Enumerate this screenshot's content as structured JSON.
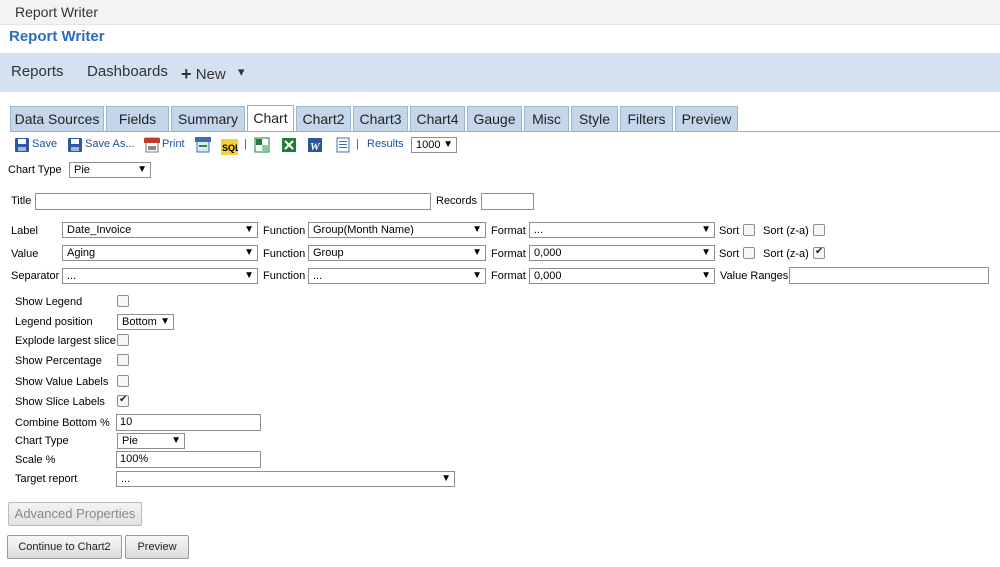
{
  "window": {
    "title": "Report Writer"
  },
  "header": {
    "brand": "Report Writer"
  },
  "nav": {
    "reports": "Reports",
    "dashboards": "Dashboards",
    "new_plus": "+",
    "new": "New",
    "caret": "▾"
  },
  "tabs": [
    {
      "label": "Data Sources",
      "active": false
    },
    {
      "label": "Fields",
      "active": false
    },
    {
      "label": "Summary",
      "active": false
    },
    {
      "label": "Chart",
      "active": true
    },
    {
      "label": "Chart2",
      "active": false
    },
    {
      "label": "Chart3",
      "active": false
    },
    {
      "label": "Chart4",
      "active": false
    },
    {
      "label": "Gauge",
      "active": false
    },
    {
      "label": "Misc",
      "active": false
    },
    {
      "label": "Style",
      "active": false
    },
    {
      "label": "Filters",
      "active": false
    },
    {
      "label": "Preview",
      "active": false
    }
  ],
  "toolbar": {
    "save": "Save",
    "save_as": "Save As...",
    "print": "Print",
    "sep": "|",
    "results_label": "Results",
    "results_value": "1000",
    "icons": [
      "save-icon",
      "save-as-icon",
      "pdf-icon",
      "html-icon",
      "sql-icon",
      "excel-icon",
      "excel2-icon",
      "word-icon",
      "doc-icon"
    ]
  },
  "chart_type_top": {
    "label": "Chart Type",
    "value": "Pie"
  },
  "title_row": {
    "title_label": "Title",
    "title_value": "",
    "records_label": "Records",
    "records_value": ""
  },
  "rows": {
    "label": {
      "name": "Label",
      "field": "Date_Invoice",
      "function_label": "Function",
      "function": "Group(Month Name)",
      "format_label": "Format",
      "format": "...",
      "sort_label": "Sort",
      "sort_za_label": "Sort (z-a)",
      "sort": false,
      "sort_za": false
    },
    "value": {
      "name": "Value",
      "field": "Aging",
      "function_label": "Function",
      "function": "Group",
      "format_label": "Format",
      "format": "0,000",
      "sort_label": "Sort",
      "sort_za_label": "Sort (z-a)",
      "sort": false,
      "sort_za": true
    },
    "separator": {
      "name": "Separator",
      "field": "...",
      "function_label": "Function",
      "function": "...",
      "format_label": "Format",
      "format": "0,000",
      "value_ranges_label": "Value Ranges",
      "value_ranges": ""
    }
  },
  "options": {
    "show_legend": {
      "label": "Show Legend",
      "checked": false
    },
    "legend_position": {
      "label": "Legend position",
      "value": "Bottom"
    },
    "explode_largest": {
      "label": "Explode largest slice",
      "checked": false
    },
    "show_percentage": {
      "label": "Show Percentage",
      "checked": false
    },
    "show_value_labels": {
      "label": "Show Value Labels",
      "checked": false
    },
    "show_slice_labels": {
      "label": "Show Slice Labels",
      "checked": true
    },
    "combine_bottom": {
      "label": "Combine Bottom %",
      "value": "10"
    },
    "chart_type": {
      "label": "Chart Type",
      "value": "Pie"
    },
    "scale": {
      "label": "Scale %",
      "value": "100%"
    },
    "target_report": {
      "label": "Target report",
      "value": "..."
    }
  },
  "buttons": {
    "advanced": "Advanced Properties",
    "continue": "Continue to Chart2",
    "preview": "Preview"
  },
  "caret": "▼"
}
